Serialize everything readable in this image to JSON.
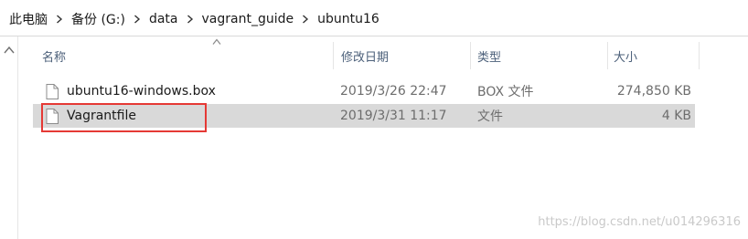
{
  "breadcrumb": [
    "此电脑",
    "备份 (G:)",
    "data",
    "vagrant_guide",
    "ubuntu16"
  ],
  "columns": {
    "name": "名称",
    "date": "修改日期",
    "type": "类型",
    "size": "大小"
  },
  "files": [
    {
      "name": "ubuntu16-windows.box",
      "date": "2019/3/26 22:47",
      "type": "BOX 文件",
      "size": "274,850 KB",
      "selected": false
    },
    {
      "name": "Vagrantfile",
      "date": "2019/3/31 11:17",
      "type": "文件",
      "size": "4 KB",
      "selected": true
    }
  ],
  "watermark": "https://blog.csdn.net/u014296316",
  "colors": {
    "selected_row": "#d9d9d9",
    "highlight_box": "#e53935",
    "header_text": "#4c607a"
  },
  "icons": {
    "breadcrumb_separator": "chevron-right-icon",
    "file": "document-icon",
    "sort": "sort-ascending-icon"
  }
}
